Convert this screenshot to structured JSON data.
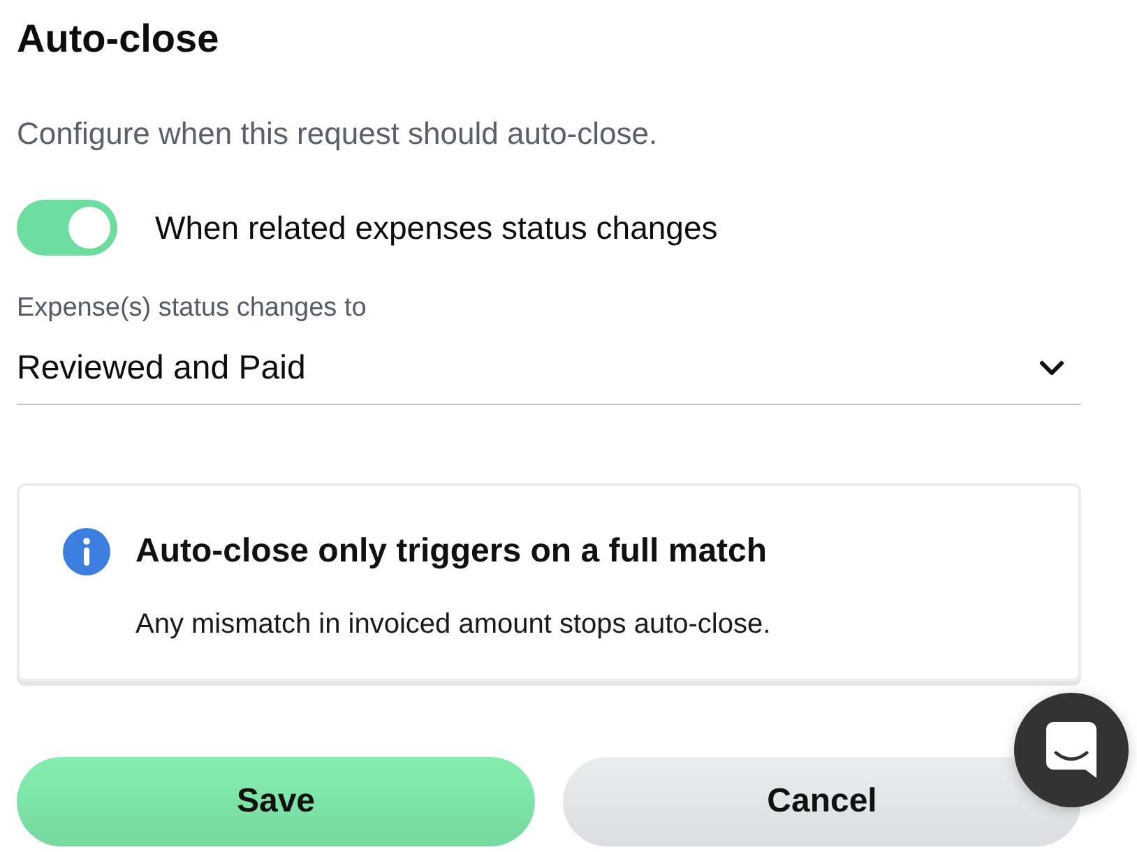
{
  "title": "Auto-close",
  "description": "Configure when this request should auto-close.",
  "toggle": {
    "label": "When related expenses status changes",
    "on": true
  },
  "status_select": {
    "label": "Expense(s) status changes to",
    "value": "Reviewed and Paid"
  },
  "info_card": {
    "heading": "Auto-close only triggers on a full match",
    "body": "Any mismatch in invoiced amount stops auto-close."
  },
  "buttons": [
    {
      "label": "Save",
      "kind": "primary"
    },
    {
      "label": "Cancel",
      "kind": "secondary"
    }
  ]
}
